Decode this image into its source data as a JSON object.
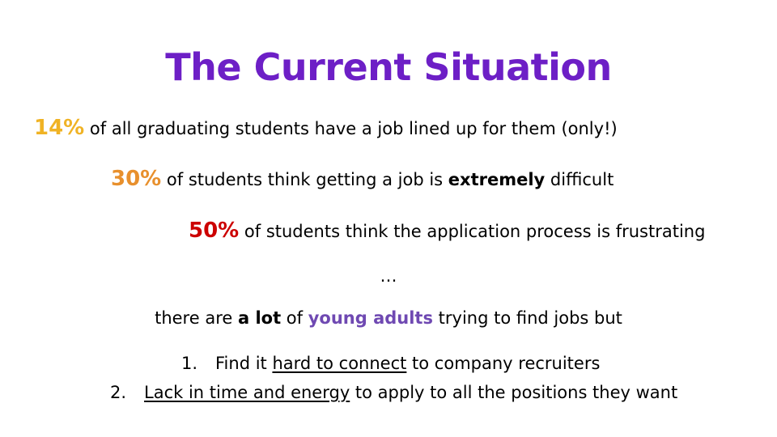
{
  "colors": {
    "title": "#6d1fc6",
    "stat_14": "#f0b325",
    "stat_30": "#e8902d",
    "stat_50": "#cc0000",
    "highlight": "#6f49b2",
    "text": "#000000"
  },
  "title": "The Current Situation",
  "stats": [
    {
      "value": "14%",
      "text": " of all graduating students have a job lined up for them (only!)"
    },
    {
      "value": "30%",
      "text_before": " of students think getting a job is ",
      "bold": "extremely",
      "text_after": " difficult"
    },
    {
      "value": "50%",
      "text": " of students think the application process is frustrating"
    }
  ],
  "ellipsis": "…",
  "summary": {
    "before": "there are ",
    "bold": "a lot",
    "mid": " of ",
    "highlight": "young adults",
    "after": " trying to find jobs but"
  },
  "list": [
    {
      "number": "1.",
      "underlined": "hard to connect",
      "before": "Find it ",
      "after": " to company recruiters"
    },
    {
      "number": "2.",
      "underlined": "Lack in time and energy",
      "before": "",
      "after": " to apply to all the positions they want"
    }
  ]
}
